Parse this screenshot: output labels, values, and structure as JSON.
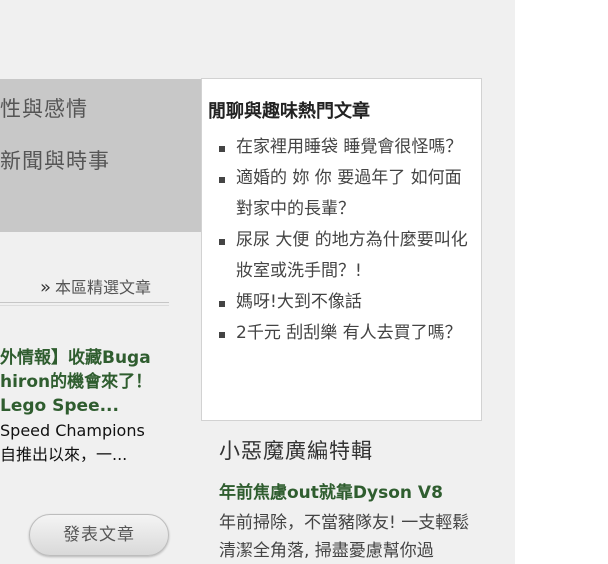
{
  "menu": {
    "items": [
      {
        "label": "性與感情"
      },
      {
        "label": "新聞與時事"
      }
    ]
  },
  "featured": {
    "chevron": "»",
    "label": "本區精選文章",
    "article": {
      "title_lines": [
        "外情報】收藏Buga",
        "hiron的機會來了！",
        "Lego Spee..."
      ],
      "desc_lines": [
        "Speed Champions",
        "自推出以來，一..."
      ]
    }
  },
  "actions": {
    "post_button": "發表文章"
  },
  "hot_topics": {
    "title": "閒聊與趣味熱門文章",
    "items": [
      {
        "label": "在家裡用睡袋 睡覺會很怪嗎？"
      },
      {
        "label": "適婚的 妳 你 要過年了 如何面對家中的長輩？"
      },
      {
        "label": "尿尿 大便 的地方為什麼要叫化妝室或洗手間？!"
      },
      {
        "label": "媽呀!大到不像話"
      },
      {
        "label": "2千元 刮刮樂 有人去買了嗎？"
      }
    ]
  },
  "promo": {
    "title": "小惡魔廣編特輯",
    "subtitle": "年前焦慮out就靠Dyson V8",
    "desc": "年前掃除，不當豬隊友! 一支輕鬆清潔全角落, 掃盡憂慮幫你過"
  }
}
